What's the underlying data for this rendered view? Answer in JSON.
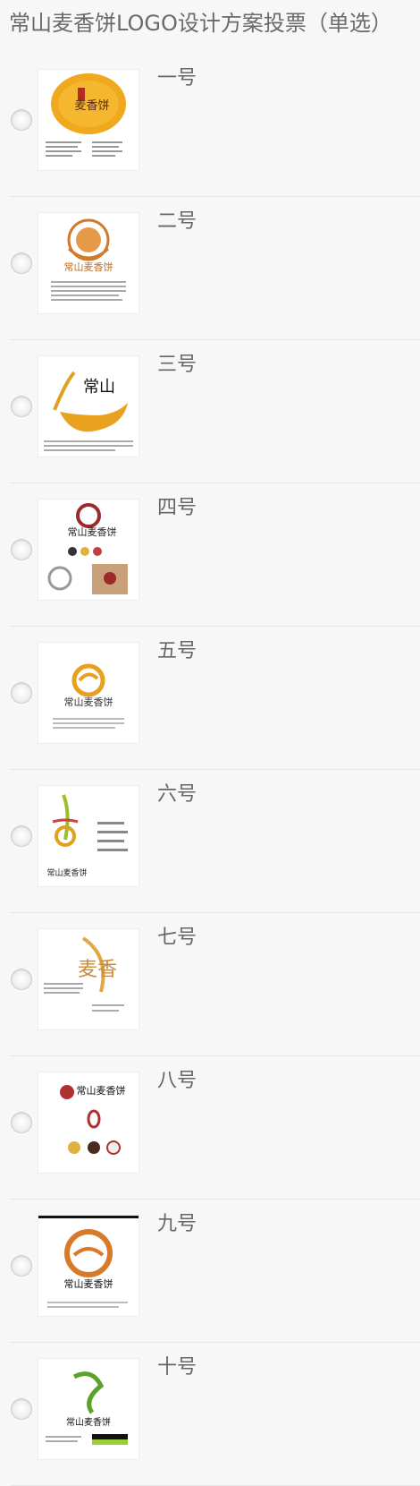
{
  "page": {
    "title": "常山麦香饼LOGO设计方案投票（单选）"
  },
  "options": [
    {
      "label": "一号",
      "image_text": "麦香饼"
    },
    {
      "label": "二号",
      "image_text": "常山麦香饼"
    },
    {
      "label": "三号",
      "image_text": "常山"
    },
    {
      "label": "四号",
      "image_text": "常山麦香饼"
    },
    {
      "label": "五号",
      "image_text": "常山麦香饼"
    },
    {
      "label": "六号",
      "image_text": "常山麦香饼"
    },
    {
      "label": "七号",
      "image_text": "麦香"
    },
    {
      "label": "八号",
      "image_text": "常山麦香饼"
    },
    {
      "label": "九号",
      "image_text": "常山麦香饼"
    },
    {
      "label": "十号",
      "image_text": "常山麦香饼"
    }
  ],
  "colors": {
    "background": "#f7f7f7",
    "divider": "#e3e3e3",
    "text": "#666666"
  }
}
